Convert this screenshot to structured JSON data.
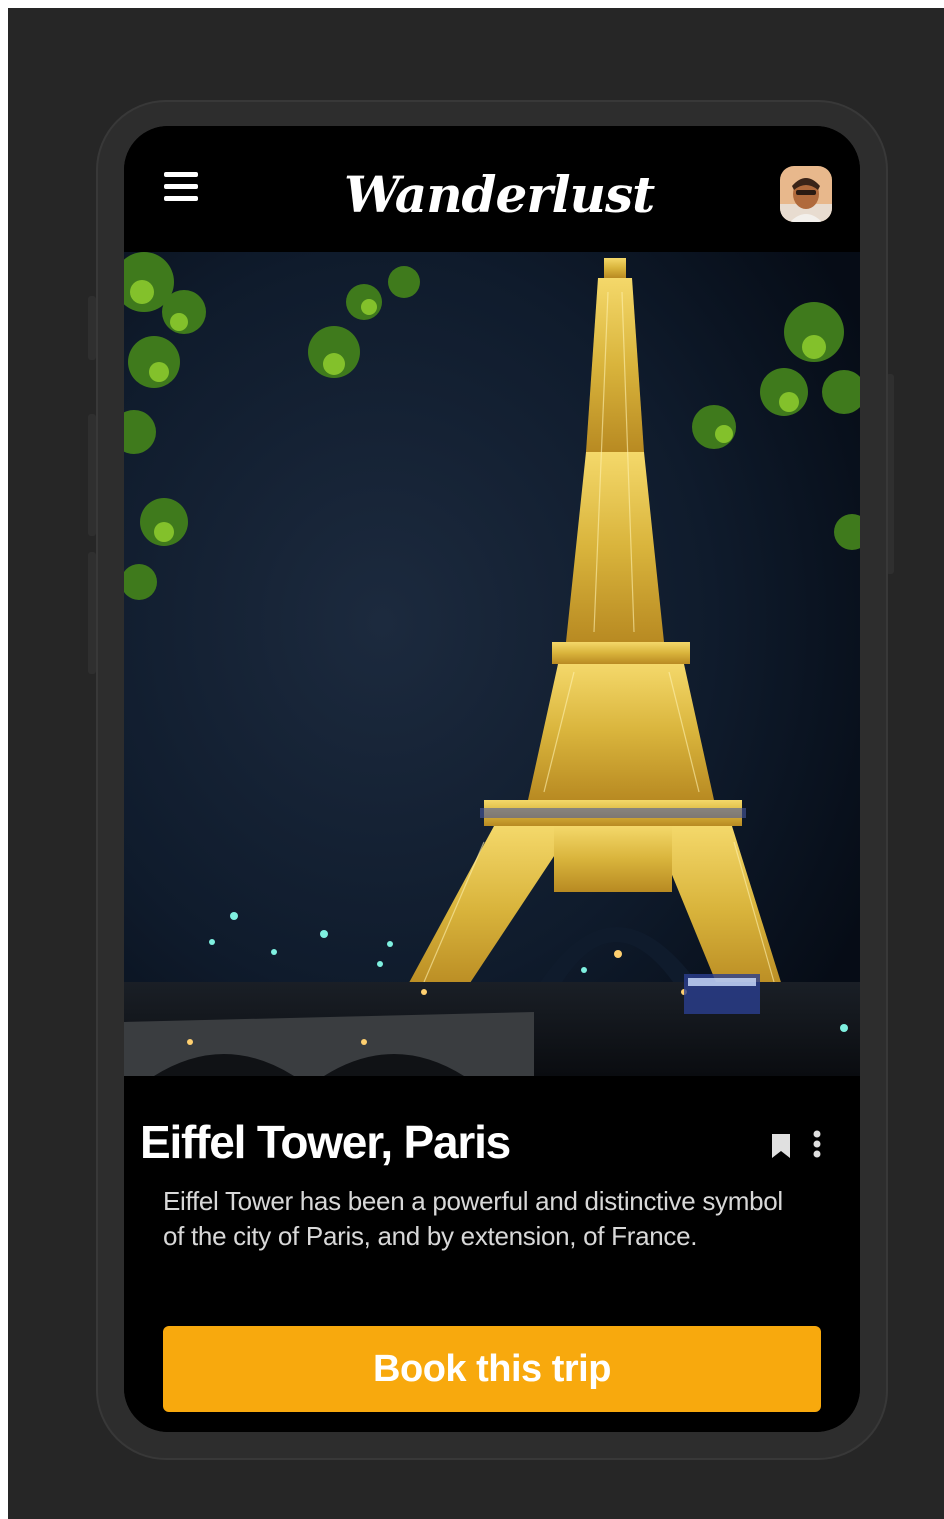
{
  "app": {
    "name": "Wanderlust"
  },
  "header": {
    "menu_icon": "hamburger-menu-icon",
    "avatar_icon": "user-avatar"
  },
  "hero": {
    "image": "eiffel-tower-night-photo"
  },
  "place": {
    "title": "Eiffel Tower, Paris",
    "description": "Eiffel Tower has been a powerful and distinctive symbol of the city of Paris, and by extension, of France.",
    "bookmark_icon": "bookmark-icon",
    "more_icon": "more-vertical-icon"
  },
  "cta": {
    "label": "Book this trip",
    "color": "#f8a90d"
  },
  "colors": {
    "backdrop": "#262626",
    "screen": "#000000",
    "text": "#ffffff"
  }
}
